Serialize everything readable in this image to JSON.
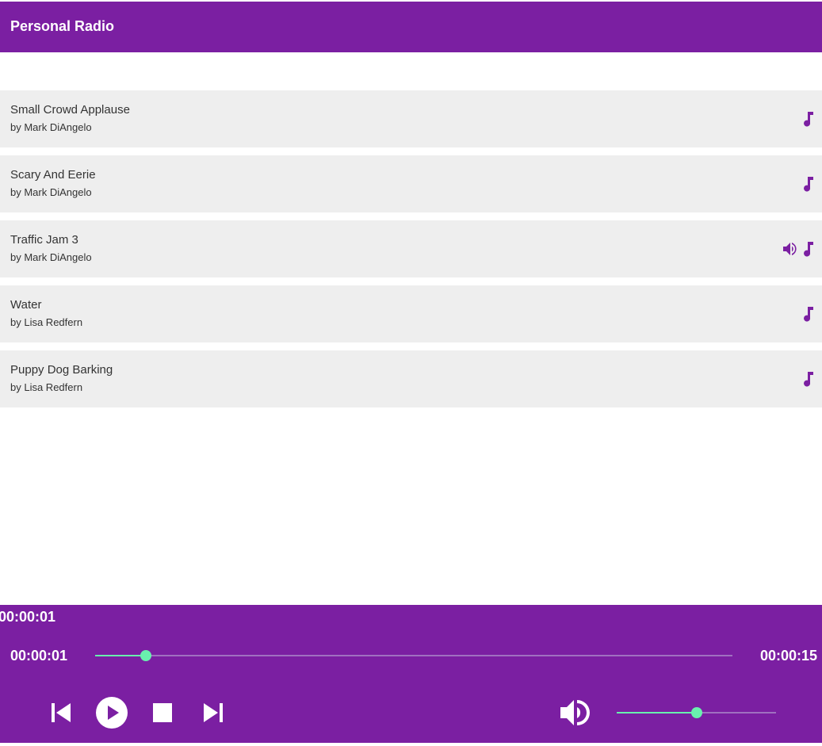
{
  "app": {
    "title": "Personal Radio",
    "accent_color": "#7b1fa2",
    "highlight_color": "#69f0ae",
    "row_background": "#eeeeee"
  },
  "tracks": [
    {
      "title": "Small Crowd Applause",
      "artist": "by Mark DiAngelo",
      "playing": false,
      "icon": "music-note-icon"
    },
    {
      "title": "Scary And Eerie",
      "artist": "by Mark DiAngelo",
      "playing": false,
      "icon": "music-note-icon"
    },
    {
      "title": "Traffic Jam 3",
      "artist": "by Mark DiAngelo",
      "playing": true,
      "icon": "music-note-icon"
    },
    {
      "title": "Water",
      "artist": "by Lisa Redfern",
      "playing": false,
      "icon": "music-note-icon"
    },
    {
      "title": "Puppy Dog Barking",
      "artist": "by Lisa Redfern",
      "playing": false,
      "icon": "music-note-icon"
    }
  ],
  "player": {
    "elapsed_header": "00:00:01",
    "current_time": "00:00:01",
    "total_time": "00:00:15",
    "progress_fraction": 0.08,
    "volume_fraction": 0.5,
    "controls": [
      "skip-previous-icon",
      "play-icon",
      "stop-icon",
      "skip-next-icon",
      "volume-up-icon"
    ]
  }
}
